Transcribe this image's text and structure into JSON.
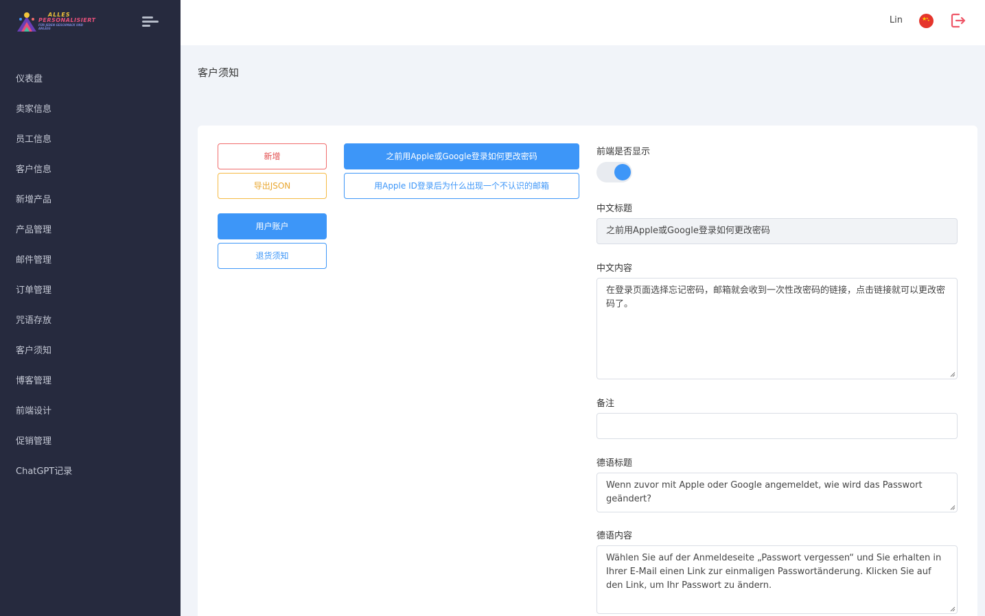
{
  "brand": {
    "line1": "ALLES",
    "line2": "PERSONALISIERT",
    "line3": "FÜR JEDEN GESCHMACK UND ANLASS"
  },
  "sidebar": {
    "items": [
      {
        "label": "仪表盘"
      },
      {
        "label": "卖家信息"
      },
      {
        "label": "员工信息"
      },
      {
        "label": "客户信息"
      },
      {
        "label": "新增产品"
      },
      {
        "label": "产品管理"
      },
      {
        "label": "邮件管理"
      },
      {
        "label": "订单管理"
      },
      {
        "label": "咒语存放"
      },
      {
        "label": "客户须知"
      },
      {
        "label": "博客管理"
      },
      {
        "label": "前端设计"
      },
      {
        "label": "促销管理"
      },
      {
        "label": "ChatGPT记录"
      }
    ]
  },
  "header": {
    "user": "Lin",
    "language_icon": "china-flag-icon",
    "logout_icon": "logout-icon"
  },
  "page": {
    "title": "客户须知"
  },
  "actions": {
    "add": "新增",
    "export_json": "导出JSON",
    "categories": [
      "用户账户",
      "退货须知"
    ],
    "selected_category": "用户账户"
  },
  "articles": [
    {
      "title": "之前用Apple或Google登录如何更改密码",
      "selected": true
    },
    {
      "title": "用Apple ID登录后为什么出现一个不认识的邮箱",
      "selected": false
    }
  ],
  "form": {
    "show_frontend_label": "前端是否显示",
    "show_frontend": true,
    "cn_title_label": "中文标题",
    "cn_title": "之前用Apple或Google登录如何更改密码",
    "cn_content_label": "中文内容",
    "cn_content": "在登录页面选择忘记密码，邮箱就会收到一次性改密码的链接，点击链接就可以更改密码了。",
    "note_label": "备注",
    "note": "",
    "de_title_label": "德语标题",
    "de_title": "Wenn zuvor mit Apple oder Google angemeldet, wie wird das Passwort geändert?",
    "de_content_label": "德语内容",
    "de_content": "Wählen Sie auf der Anmeldeseite „Passwort vergessen“ und Sie erhalten in Ihrer E-Mail einen Link zur einmaligen Passwortänderung. Klicken Sie auf den Link, um Ihr Passwort zu ändern."
  },
  "colors": {
    "sidebar_bg": "#262a3e",
    "accent": "#3d96f8",
    "danger": "#e24d4d",
    "warning": "#e9a730"
  }
}
